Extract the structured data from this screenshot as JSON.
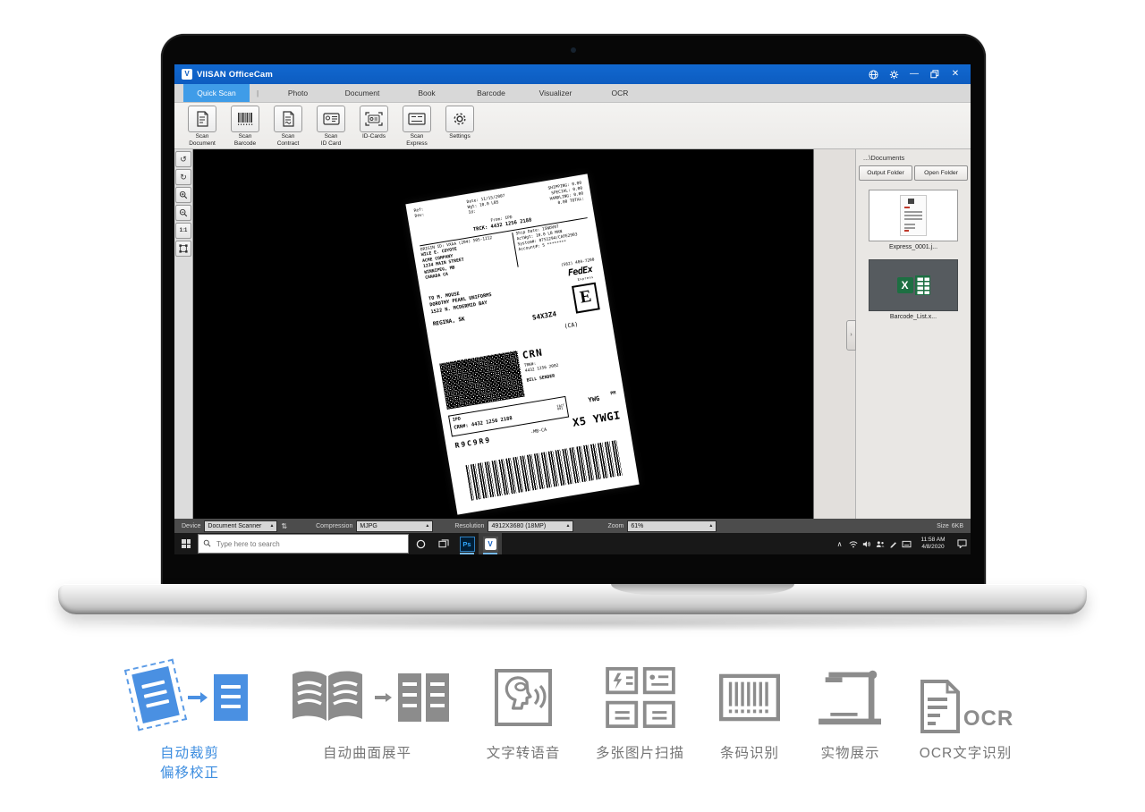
{
  "colors": {
    "titlebar_blue": "#0d5cc0",
    "tab_active_blue": "#3f9ce8",
    "feature_blue": "#4a90e2",
    "feature_gray": "#8c8c8c",
    "excel_green": "#1d6f42",
    "statusbar_gray": "#4c4c4c",
    "taskbar_underline": "#76b9ed"
  },
  "window": {
    "title": "VIISAN OfficeCam",
    "logo_text": "V"
  },
  "icons": {
    "minimize": "—",
    "close": "✕",
    "tab_separator": "|",
    "rotate_ccw": "↺",
    "rotate_cw": "↻",
    "ratio": "1:1",
    "chevron_right": "›",
    "dropdown_up": "▲",
    "swap": "⇅",
    "tray_chevron": "∧"
  },
  "tabs": {
    "items": [
      {
        "label": "Quick Scan"
      },
      {
        "label": "Photo"
      },
      {
        "label": "Document"
      },
      {
        "label": "Book"
      },
      {
        "label": "Barcode"
      },
      {
        "label": "Visualizer"
      },
      {
        "label": "OCR"
      }
    ]
  },
  "toolbar": {
    "buttons": [
      {
        "l1": "Scan",
        "l2": "Document"
      },
      {
        "l1": "Scan",
        "l2": "Barcode"
      },
      {
        "l1": "Scan",
        "l2": "Contract"
      },
      {
        "l1": "Scan",
        "l2": "ID Card"
      },
      {
        "l1": "ID-Cards",
        "l2": ""
      },
      {
        "l1": "Scan",
        "l2": "Express"
      },
      {
        "l1": "Settings",
        "l2": ""
      }
    ]
  },
  "right_panel": {
    "path": "...\\Documents",
    "output_folder": "Output Folder",
    "open_folder": "Open Folder",
    "file1": "Express_0001.j...",
    "file2": "Barcode_List.x...",
    "excel_x": "X"
  },
  "status_bar": {
    "device_label": "Device",
    "device_value": "Document Scanner",
    "compression_label": "Compression",
    "compression_value": "MJPG",
    "resolution_label": "Resolution",
    "resolution_value": "4912X3680 (18MP)",
    "zoom_label": "Zoom",
    "zoom_value": "61%",
    "size_label": "Size",
    "size_value": "6KB"
  },
  "taskbar": {
    "search_placeholder": "Type here to search",
    "ps_label": "Ps",
    "time": "11:58 AM",
    "date": "4/8/2020"
  },
  "shipping_label": {
    "ref": "Ref:",
    "dev": "Dev:",
    "date": "Date: 11/15/2007",
    "wgt": "Wgt: 10.0 LBS",
    "id": "Id:",
    "shipping": "SHIPPING: 0.00",
    "special": "SPECIAL: 0.00",
    "handling": "HANDLING: 0.00",
    "total": "0.00 TOTAL:",
    "from": "From: IPD",
    "trck": "TRCK: 4432 1256 2188",
    "origin": "ORIGIN ID: VXAA (204) 505-1212",
    "sender1": "WILE E. COYOTE",
    "sender2": "ACME COMPANY",
    "sender3": "1234 MAIN STREET",
    "sender4": "WINNIPEG, MB",
    "sender5": "CANADA CA",
    "ship_date": "Ship Date: 15NOV07",
    "act_wgt": "ActWgt: 10.0 LB MAN",
    "system": "System#: 0751294/CAFE2903",
    "account": "Account#: S ********",
    "phone": "(562) 404-7200",
    "fedex": "FedEx",
    "express": "Express",
    "e_mark": "E",
    "to1": "TO M. MOUSE",
    "to2": "DOROTHY PEARL UNIFORMS",
    "to3": "1522 N. MCDERMID BAY",
    "city": "REGINA, SK",
    "postal": "S4X3Z4",
    "country": "(CA)",
    "crn": "CRN",
    "trk2a": "TRK#:",
    "trk2b": "4432 1256 2002",
    "bill": "BILL SENDER",
    "ipd": "IPD",
    "crn2": "CRN#: 4432 1256 2188",
    "fact": "FACT\n001",
    "ywg": "YWG",
    "pm": "PM",
    "route": "-MB-CA",
    "sort": "X5 YWGI",
    "r9": "R9C9R9"
  },
  "features": {
    "f1a": "自动裁剪",
    "f1b": "偏移校正",
    "f2": "自动曲面展平",
    "f3": "文字转语音",
    "f4": "多张图片扫描",
    "f5": "条码识别",
    "f6": "实物展示",
    "f7": "OCR文字识别",
    "ocr_text": "OCR"
  }
}
